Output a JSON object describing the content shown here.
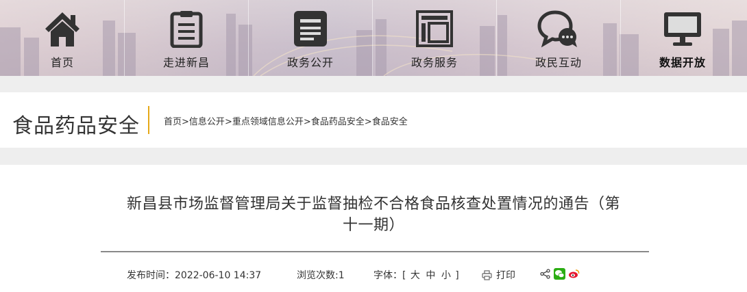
{
  "nav": {
    "items": [
      {
        "label": "首页",
        "icon": "home-icon"
      },
      {
        "label": "走进新昌",
        "icon": "document-list-icon"
      },
      {
        "label": "政务公开",
        "icon": "news-icon"
      },
      {
        "label": "政务服务",
        "icon": "service-frame-icon"
      },
      {
        "label": "政民互动",
        "icon": "chat-bubbles-icon"
      },
      {
        "label": "数据开放",
        "icon": "monitor-icon"
      }
    ],
    "active_index": 5
  },
  "section": {
    "title": "食品药品安全",
    "accent_color": "#e6a817"
  },
  "breadcrumb": {
    "items": [
      "首页",
      "信息公开",
      "重点领域信息公开",
      "食品药品安全",
      "食品安全"
    ],
    "separator": ">"
  },
  "article": {
    "title_line1": "新昌县市场监督管理局关于监督抽检不合格食品核查处置情况的通告（第",
    "title_line2": "十一期）",
    "publish_label": "发布时间：",
    "publish_time": "2022-06-10 14:37",
    "views_label": "浏览次数:",
    "views_count": "1",
    "font_label": "字体：[",
    "font_large": "大",
    "font_medium": "中",
    "font_small": "小",
    "font_close": "]",
    "print_label": "打印",
    "share_icons": [
      "share-icon",
      "wechat-icon",
      "weibo-icon"
    ]
  }
}
